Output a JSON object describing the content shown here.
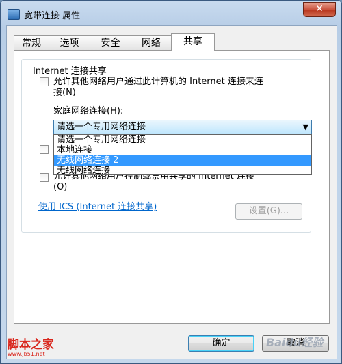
{
  "window": {
    "title": "宽带连接 属性",
    "close_label": "✕"
  },
  "tabs": [
    {
      "label": "常规"
    },
    {
      "label": "选项"
    },
    {
      "label": "安全"
    },
    {
      "label": "网络"
    },
    {
      "label": "共享",
      "active": true
    }
  ],
  "sharing": {
    "group_title": "Internet 连接共享",
    "allow_checkbox": {
      "line1": "允许其他网络用户通过此计算机的 Internet 连接来连",
      "line2": "接(N)",
      "checked": false
    },
    "home_network_label": "家庭网络连接(H):",
    "home_network_select": {
      "selected": "请选一个专用网络连接"
    },
    "dropdown_options": [
      {
        "label": "请选一个专用网络连接",
        "selected": false
      },
      {
        "label": "本地连接",
        "selected": false
      },
      {
        "label": "无线网络连接 2",
        "selected": true
      },
      {
        "label": "无线网络连接",
        "selected": false
      }
    ],
    "control_checkbox": {
      "line1": "允许其他网络用户控制或禁用共享的 Internet 连接",
      "line2": "(O)",
      "checked": false
    },
    "ics_link": "使用 ICS (Internet 连接共享)",
    "settings_button": "设置(G)..."
  },
  "footer": {
    "ok_label": "确定",
    "cancel_label": "取消"
  },
  "watermarks": {
    "left": "脚本之家",
    "left_url": "www.jb51.net",
    "right": "Baidu经验"
  }
}
